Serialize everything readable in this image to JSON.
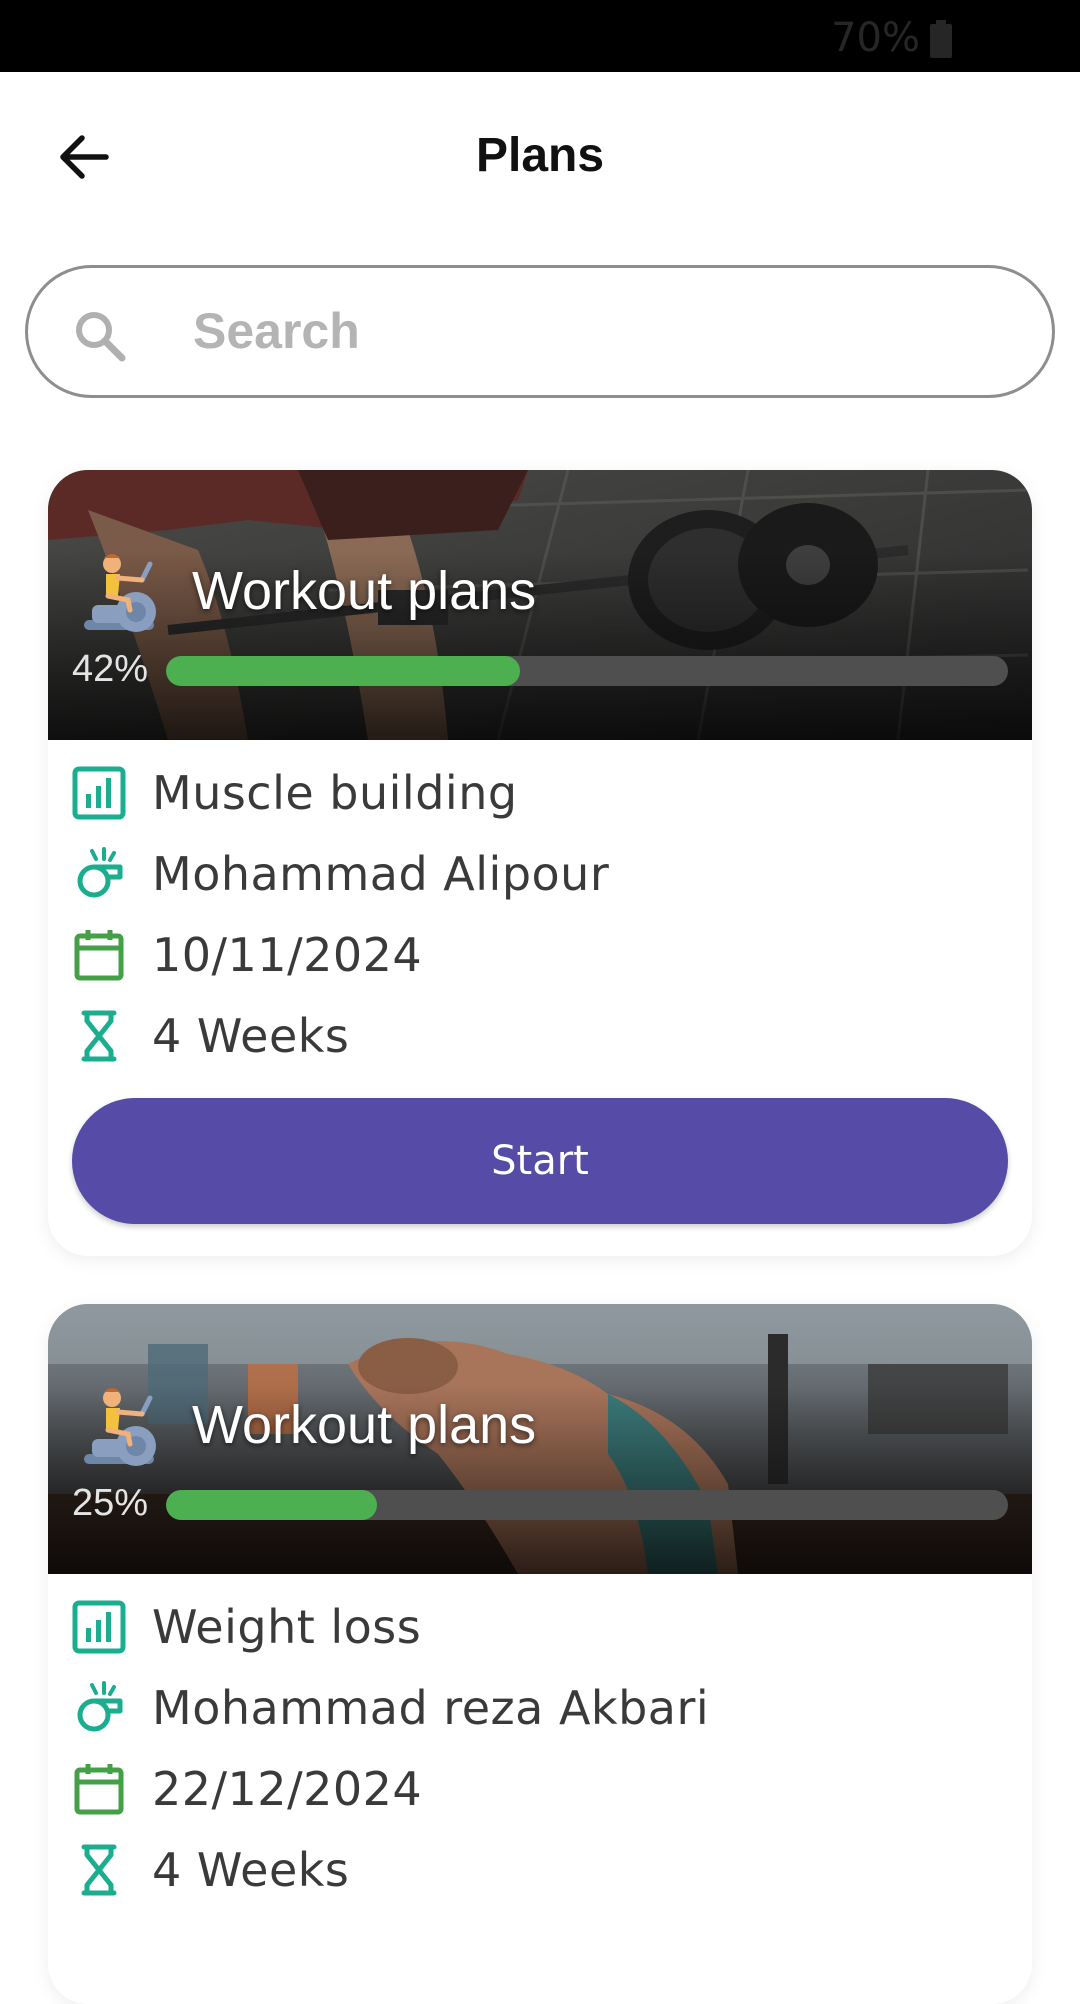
{
  "status_bar": {
    "battery_text": "70%",
    "battery_icon": "battery-icon"
  },
  "header": {
    "title": "Plans",
    "back_icon": "arrow-left-icon"
  },
  "search": {
    "placeholder": "Search",
    "value": "",
    "icon": "search-icon"
  },
  "colors": {
    "accent_purple": "#564ba6",
    "progress_green": "#4caf50",
    "icon_teal": "#1aae8f",
    "icon_green": "#43a047"
  },
  "plans": [
    {
      "banner_title": "Workout plans",
      "progress_label": "42%",
      "progress": 0.42,
      "category": "Muscle building",
      "coach": "Mohammad Alipour",
      "date": "10/11/2024",
      "duration": "4 Weeks",
      "button_label": "Start"
    },
    {
      "banner_title": "Workout plans",
      "progress_label": "25%",
      "progress": 0.25,
      "category": "Weight loss",
      "coach": "Mohammad reza Akbari",
      "date": "22/12/2024",
      "duration": "4 Weeks"
    }
  ]
}
